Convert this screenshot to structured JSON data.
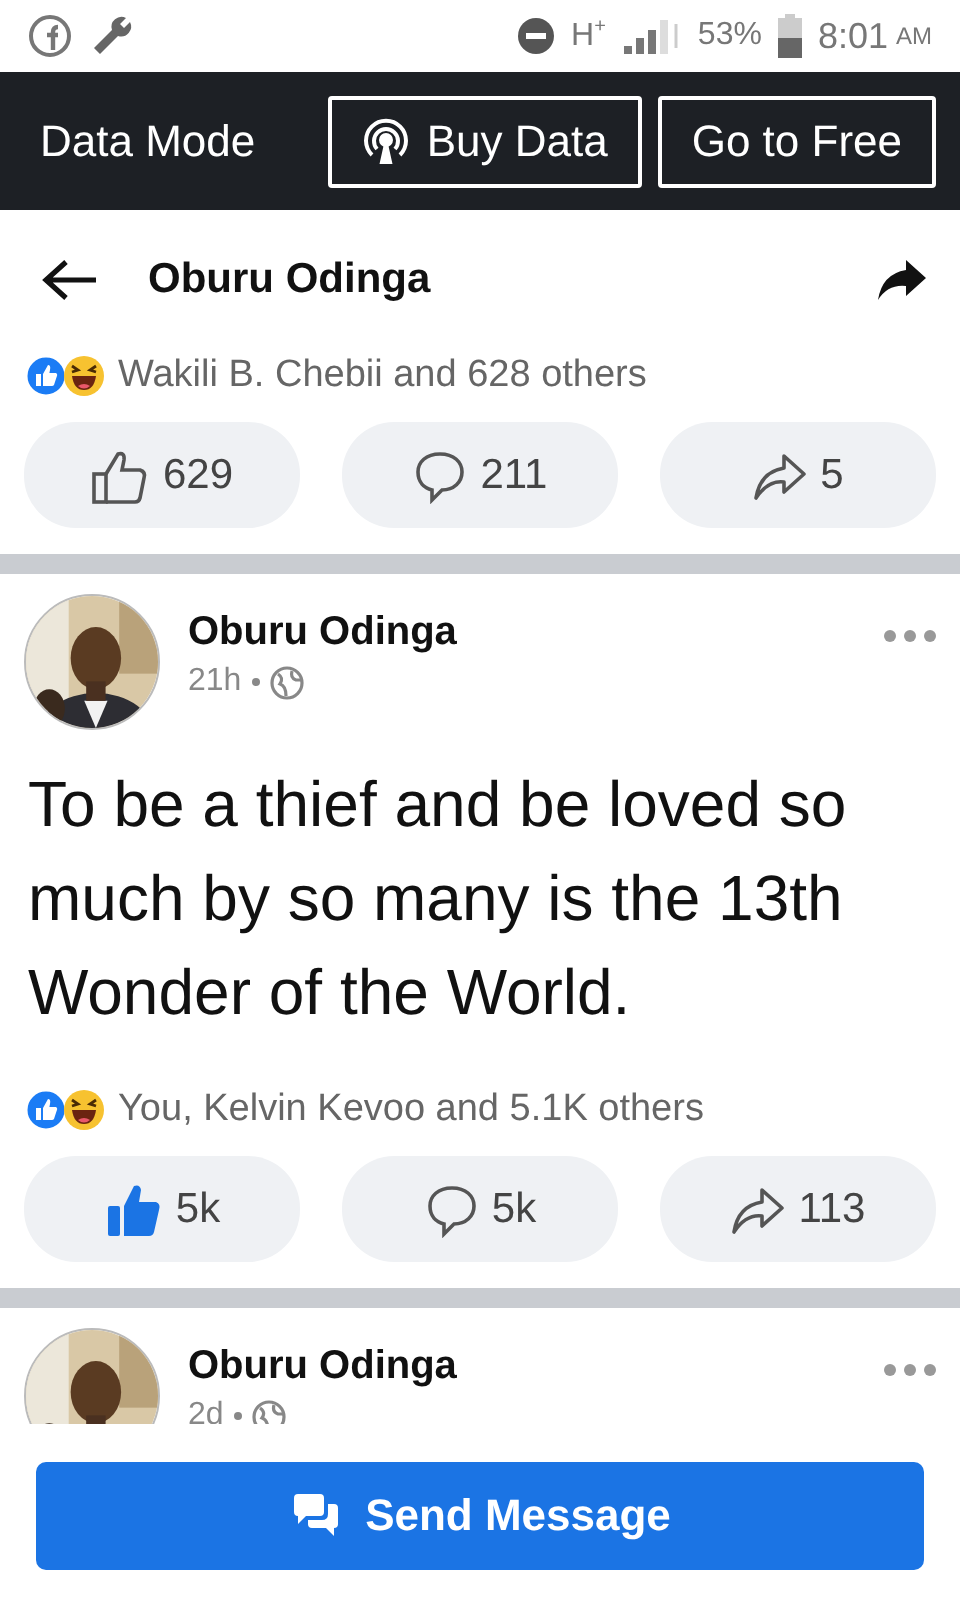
{
  "status_bar": {
    "network": "H$^{+}$",
    "battery": "53%",
    "time": "8:01",
    "time_suffix": "AM"
  },
  "data_bar": {
    "label": "Data Mode",
    "buttons": [
      {
        "label": "Buy Data",
        "kind": "buy"
      },
      {
        "label": "Go to Free",
        "kind": "plain"
      }
    ]
  },
  "header": {
    "title": "Oburu Odinga"
  },
  "posts": [
    {
      "kind": "footer",
      "reactions": "Wakili B. Chebii and 628 others",
      "likes": "629",
      "comments": "211",
      "shares": "5",
      "liked": false
    },
    {
      "kind": "full",
      "author": "Oburu Odinga",
      "time": "21h",
      "text": "To be a thief and be loved so much by so many is the 13th Wonder of the World.",
      "reactions": "You, Kelvin Kevoo and 5.1K others",
      "likes": "5k",
      "comments": "5k",
      "shares": "113",
      "liked": true
    },
    {
      "kind": "header",
      "author": "Oburu Odinga",
      "time": "2d"
    }
  ],
  "send_button": "Send Message"
}
